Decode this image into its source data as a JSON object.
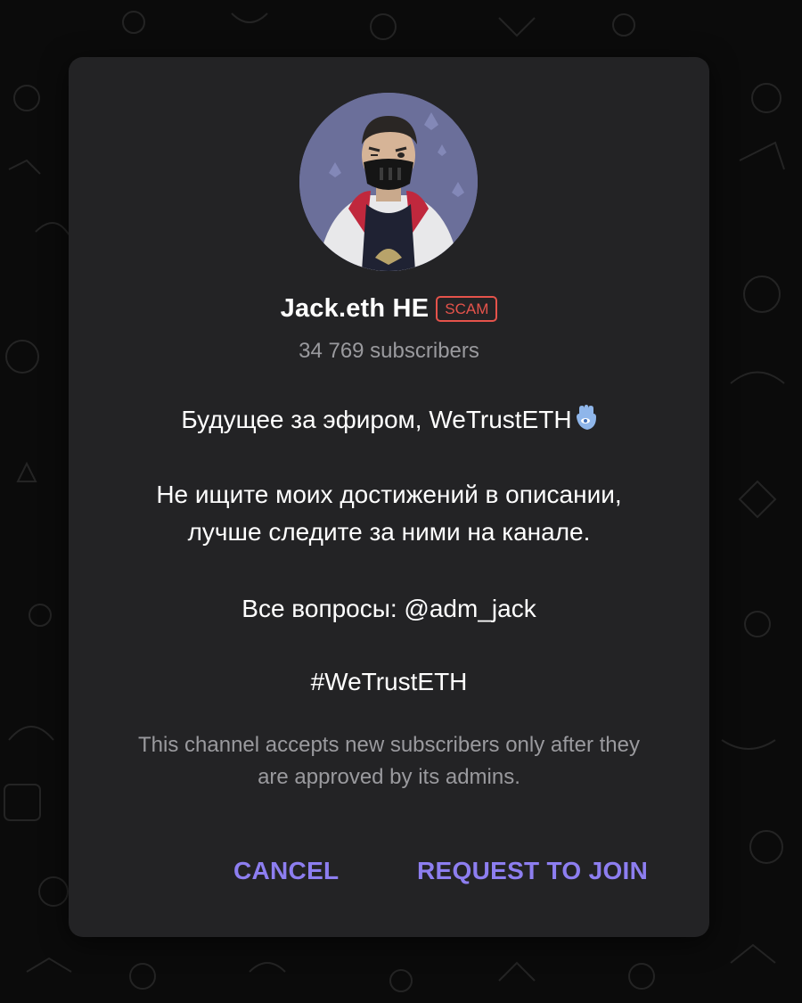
{
  "channel": {
    "name": "Jack.eth HE",
    "badge": "SCAM",
    "subscribers": "34 769 subscribers"
  },
  "description": {
    "line1": "Будущее за эфиром, WeTrustETH",
    "line2a": "Не ищите моих достижений в описании,",
    "line2b": "лучше следите за ними на канале.",
    "line3": "Все вопросы: @adm_jack",
    "line4": "#WeTrustETH"
  },
  "approval_note": {
    "line1": "This channel accepts new subscribers only after they",
    "line2": "are approved by its admins."
  },
  "actions": {
    "cancel_label": "CANCEL",
    "join_label": "REQUEST TO JOIN"
  },
  "icons": {
    "avatar": "masked-man-avatar",
    "hamsa": "hamsa-hand-icon"
  },
  "colors": {
    "dialog_bg": "#232325",
    "accent": "#8d7ef0",
    "scam_red": "#e5534b",
    "secondary_text": "#9a9a9e"
  }
}
